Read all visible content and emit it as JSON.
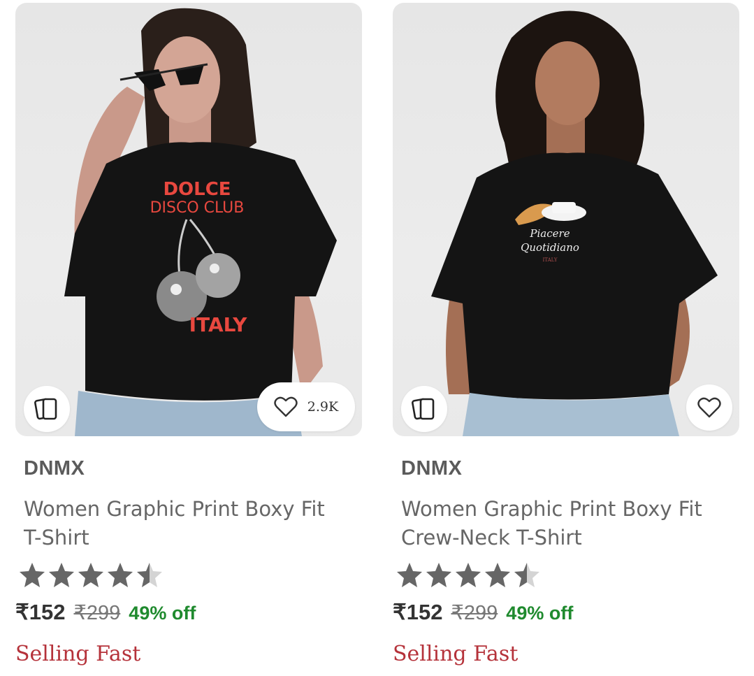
{
  "products": [
    {
      "brand": "DNMX",
      "title_line1": "Women Graphic Print Boxy Fit",
      "title_line2": "T-Shirt",
      "rating": 4.5,
      "price": "₹152",
      "mrp": "₹299",
      "discount": "49% off",
      "badge": "Selling Fast",
      "wishlist_count": "2.9K",
      "print": {
        "line1": "DOLCE",
        "line2": "DISCO CLUB",
        "line3": "ITALY"
      }
    },
    {
      "brand": "DNMX",
      "title_line1": "Women Graphic Print Boxy Fit",
      "title_line2": "Crew-Neck T-Shirt",
      "rating": 4.5,
      "price": "₹152",
      "mrp": "₹299",
      "discount": "49% off",
      "badge": "Selling Fast",
      "wishlist_count": "",
      "print": {
        "line1": "Piacere",
        "line2": "Quotidiano",
        "line3": "ITALY"
      }
    }
  ],
  "colors": {
    "star_filled": "#666666",
    "star_empty": "#d4d4d4",
    "discount": "#1f8a2e",
    "badge": "#b5323a",
    "print_red": "#e8483f"
  }
}
